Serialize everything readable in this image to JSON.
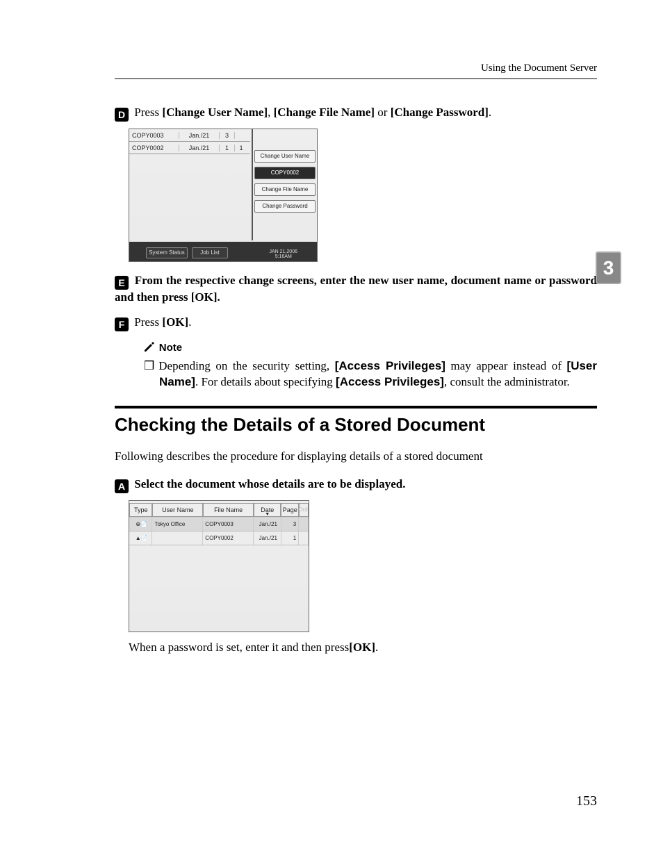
{
  "header": "Using the Document Server",
  "chapter_tab": "3",
  "page_number": "153",
  "step4": {
    "marker": "D",
    "prefix": "Press ",
    "b1": "[Change User Name]",
    "sep1": ", ",
    "b2": "[Change File Name]",
    "sep2": " or ",
    "b3": "[Change Password]",
    "end": "."
  },
  "shot1": {
    "rows": [
      {
        "file": "COPY0003",
        "date": "Jan./21",
        "page": "3",
        "ord": ""
      },
      {
        "file": "COPY0002",
        "date": "Jan./21",
        "page": "1",
        "ord": "1"
      }
    ],
    "right_label1": "Change User Name",
    "right_value": "COPY0002",
    "right_label2": "Change File Name",
    "right_label3": "Change Password",
    "footer_b1": "System Status",
    "footer_b2": "Job List",
    "timestamp_l1": "JAN   21,2006",
    "timestamp_l2": "5:16AM"
  },
  "step5": {
    "marker": "E",
    "t1": "From the respective change screens, enter the new user name, document name or password and then press ",
    "b1": "[OK]",
    "t2": "."
  },
  "step6": {
    "marker": "F",
    "prefix": "Press ",
    "b1": "[OK]",
    "end": "."
  },
  "note": {
    "heading": "Note",
    "bullet": "❒",
    "t1": "Depending on the security setting, ",
    "b1": "[Access Privileges]",
    "t2": " may appear instead of ",
    "b2": "[User Name]",
    "t3": ". For details about specifying ",
    "b3": "[Access Privileges]",
    "t4": ", consult the administrator."
  },
  "section_heading": "Checking the Details of a Stored Document",
  "intro": "Following describes the procedure for displaying details of a stored document",
  "stepA": {
    "marker": "A",
    "text": "Select the document whose details are to be displayed."
  },
  "shot2": {
    "head": {
      "type": "Type",
      "user": "User Name",
      "file": "File Name",
      "date": "Date",
      "page": "Page",
      "ord": "Ord"
    },
    "rows": [
      {
        "type_icon": "⊕📄",
        "user": "Tokyo Office",
        "file": "COPY0003",
        "date": "Jan./21",
        "page": "3",
        "selected": true
      },
      {
        "type_icon": "▲📄",
        "user": "",
        "file": "COPY0002",
        "date": "Jan./21",
        "page": "1",
        "selected": false
      }
    ]
  },
  "caption_after": {
    "t1": "When a password is set, enter it and then press",
    "b1": "[OK]",
    "t2": "."
  }
}
